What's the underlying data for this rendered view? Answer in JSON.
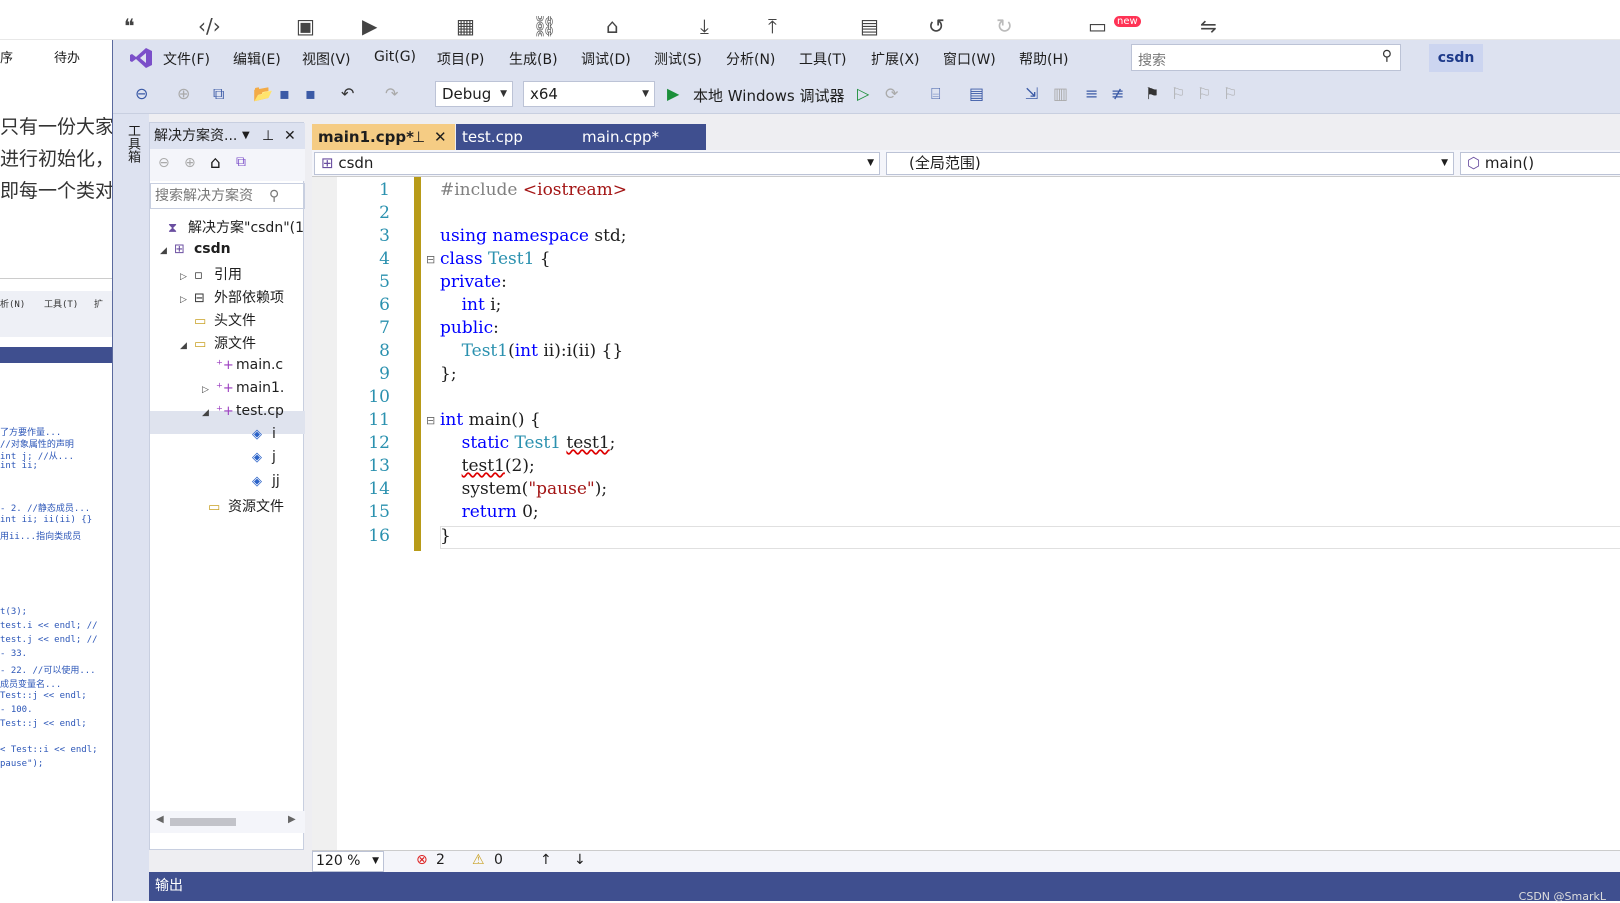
{
  "bg": {
    "left_col": [
      "序",
      "待办"
    ],
    "text_lines": [
      "只有一份大家",
      "进行初始化，",
      "即每一个类对"
    ],
    "thumb_lines": [
      "了方要作量...",
      "//对象属性的声明",
      "int j;  //从...",
      "int ii;",
      "- 2. //静态成员...",
      "int ii; ii(ii) {}",
      "用ii...指向类成员"
    ],
    "thumb_code": [
      "t(3);",
      "test.i << endl; //",
      "test.j << endl; //",
      "- 33.",
      "- 22. //可以使用...",
      "成员变量名...",
      "Test::j << endl;",
      "- 100.",
      "Test::j << endl;",
      "< Test::i << endl;",
      "pause\");"
    ],
    "thumb_menu": [
      "析(N)",
      "工具(T)",
      "扩"
    ]
  },
  "menubar": {
    "items": [
      "文件(F)",
      "编辑(E)",
      "视图(V)",
      "Git(G)",
      "项目(P)",
      "生成(B)",
      "调试(D)",
      "测试(S)",
      "分析(N)",
      "工具(T)",
      "扩展(X)",
      "窗口(W)",
      "帮助(H)"
    ],
    "search_placeholder": "搜索",
    "profile_label": "csdn"
  },
  "toolbar": {
    "config": "Debug",
    "platform": "x64",
    "run_label": "本地 Windows 调试器"
  },
  "toolstrip_label": "工具箱",
  "solution_explorer": {
    "title": "解决方案资...",
    "search_placeholder": "搜索解决方案资",
    "items": [
      {
        "label": "解决方案\"csdn\"(1",
        "icon": "solution-icon"
      },
      {
        "label": "csdn",
        "icon": "project-icon"
      },
      {
        "label": "引用",
        "icon": "references-icon"
      },
      {
        "label": "外部依赖项",
        "icon": "external-deps-icon"
      },
      {
        "label": "头文件",
        "icon": "folder-icon"
      },
      {
        "label": "源文件",
        "icon": "folder-icon"
      },
      {
        "label": "main.c",
        "icon": "cpp-file-icon"
      },
      {
        "label": "main1.",
        "icon": "cpp-file-icon"
      },
      {
        "label": "test.cp",
        "icon": "cpp-file-icon"
      },
      {
        "label": "i",
        "icon": "field-icon"
      },
      {
        "label": "j",
        "icon": "field-icon"
      },
      {
        "label": "jj",
        "icon": "field-icon"
      },
      {
        "label": "资源文件",
        "icon": "folder-icon"
      }
    ]
  },
  "editor": {
    "tabs": [
      "main1.cpp*",
      "test.cpp",
      "main.cpp*"
    ],
    "project_combo": "csdn",
    "scope_combo": "(全局范围)",
    "member_combo": "main()",
    "line_numbers": [
      "1",
      "2",
      "3",
      "4",
      "5",
      "6",
      "7",
      "8",
      "9",
      "10",
      "11",
      "12",
      "13",
      "14",
      "15",
      "16"
    ]
  },
  "status": {
    "zoom": "120 %",
    "errors": "2",
    "warnings": "0"
  },
  "output_label": "输出",
  "watermark": "CSDN @SmarkL"
}
